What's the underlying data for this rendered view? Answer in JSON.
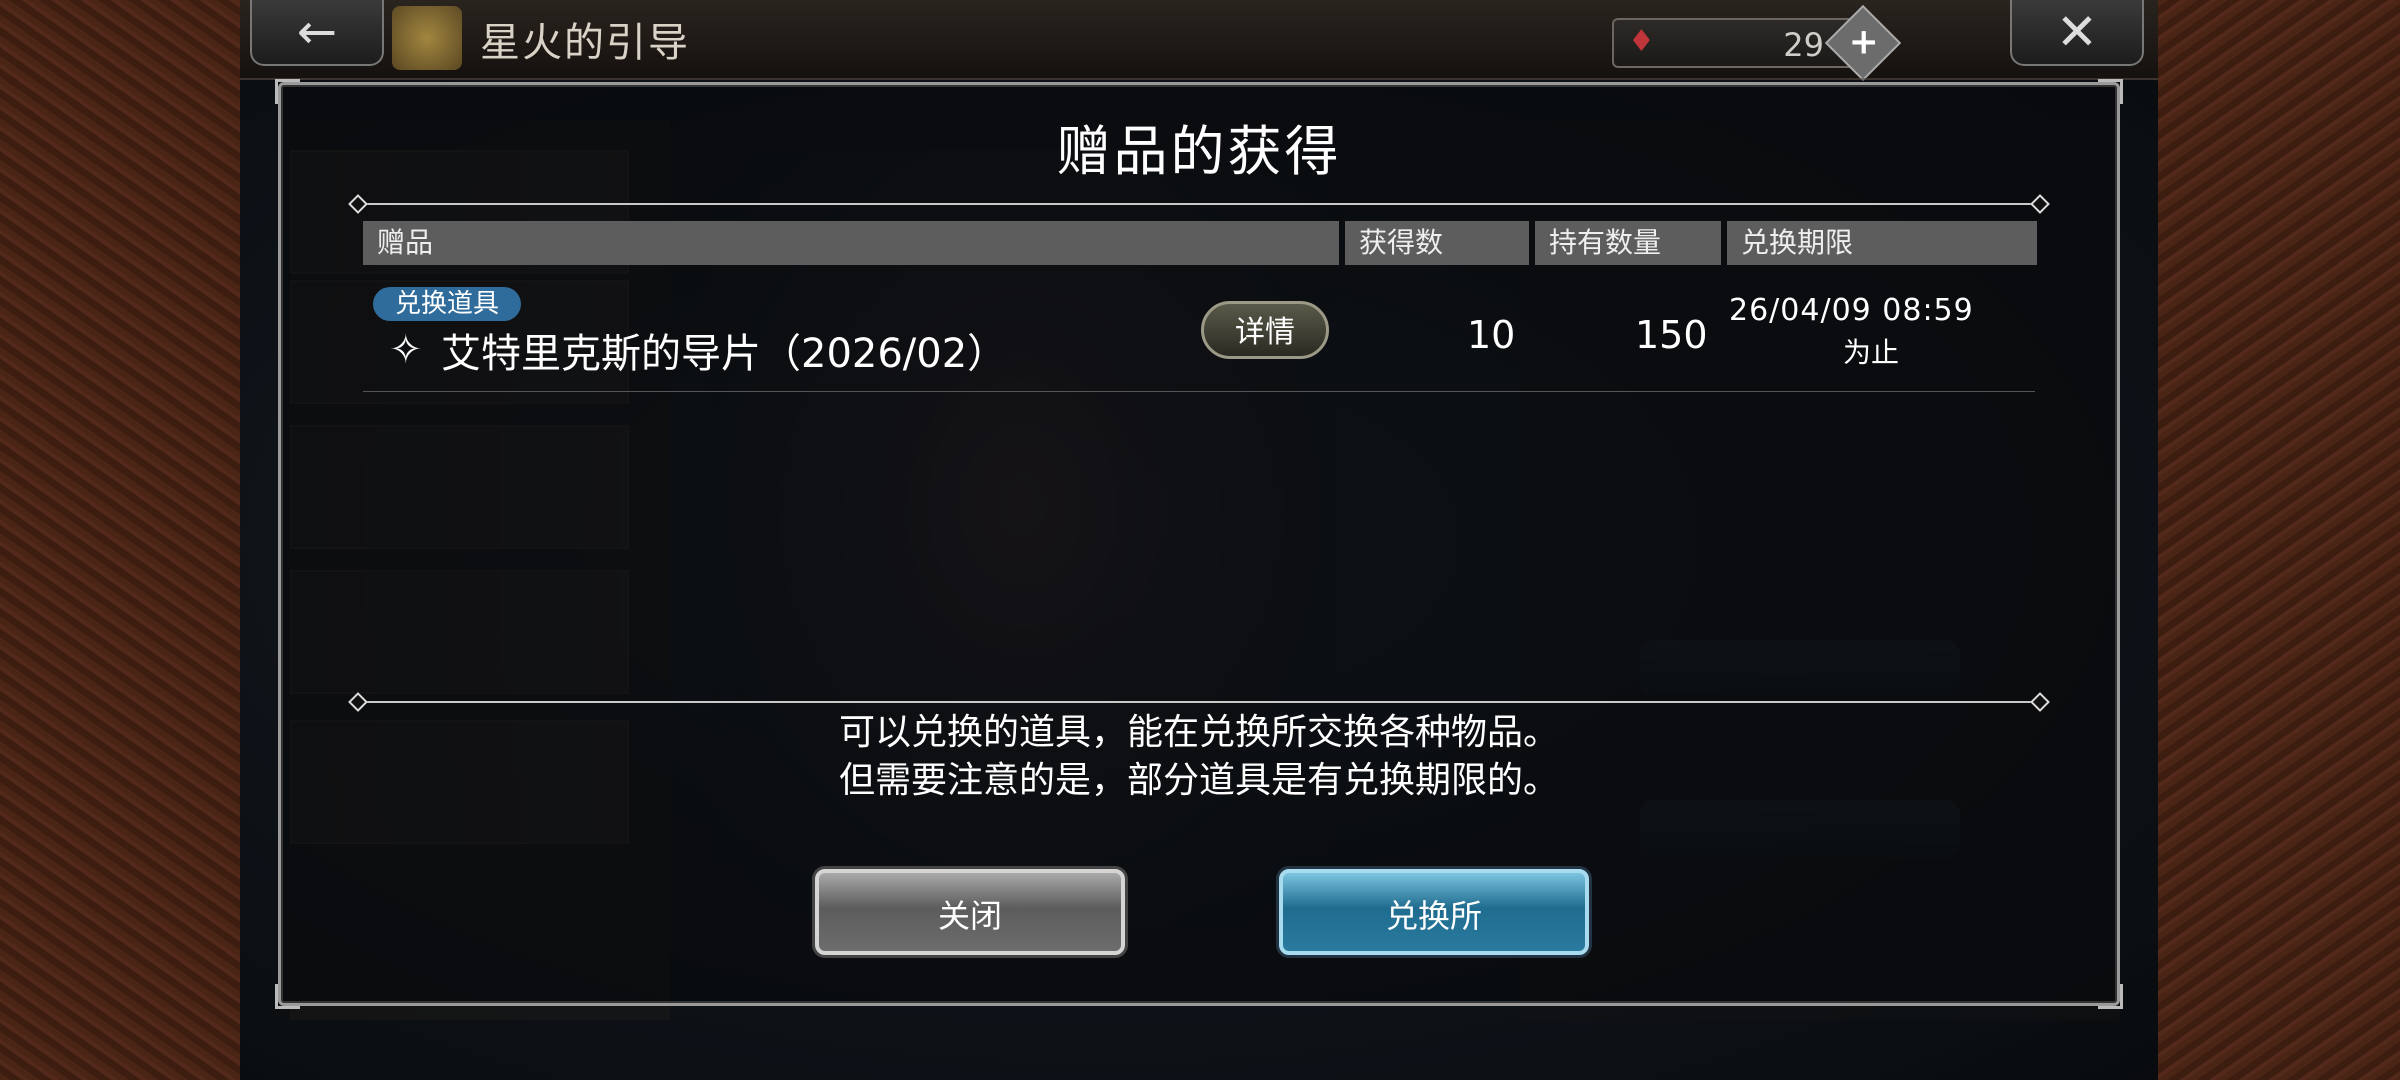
{
  "header": {
    "title": "星火的引导",
    "back_icon": "arrow-left-icon",
    "close_icon": "close-icon",
    "currency": {
      "icon": "gem-icon",
      "count": "29",
      "add_icon": "plus-icon"
    }
  },
  "dialog": {
    "title": "赠品的获得",
    "columns": [
      "赠品",
      "获得数",
      "持有数量",
      "兑换期限"
    ],
    "item": {
      "badge": "兑换道具",
      "name": "艾特里克斯的导片（2026/02）",
      "detail_label": "详情",
      "obtained": "10",
      "held": "150",
      "expire_date": "26/04/09 08:59",
      "expire_until": "为止"
    },
    "message_line1": "可以兑换的道具，能在兑换所交换各种物品。",
    "message_line2": "但需要注意的是，部分道具是有兑换期限的。",
    "close_label": "关闭",
    "exchange_label": "兑换所"
  },
  "colors": {
    "badge": "#2f6c9b",
    "exchange_button": "#2a7ba0",
    "close_button": "#6d6d6d",
    "dialog_border": "#9a9a9a"
  }
}
